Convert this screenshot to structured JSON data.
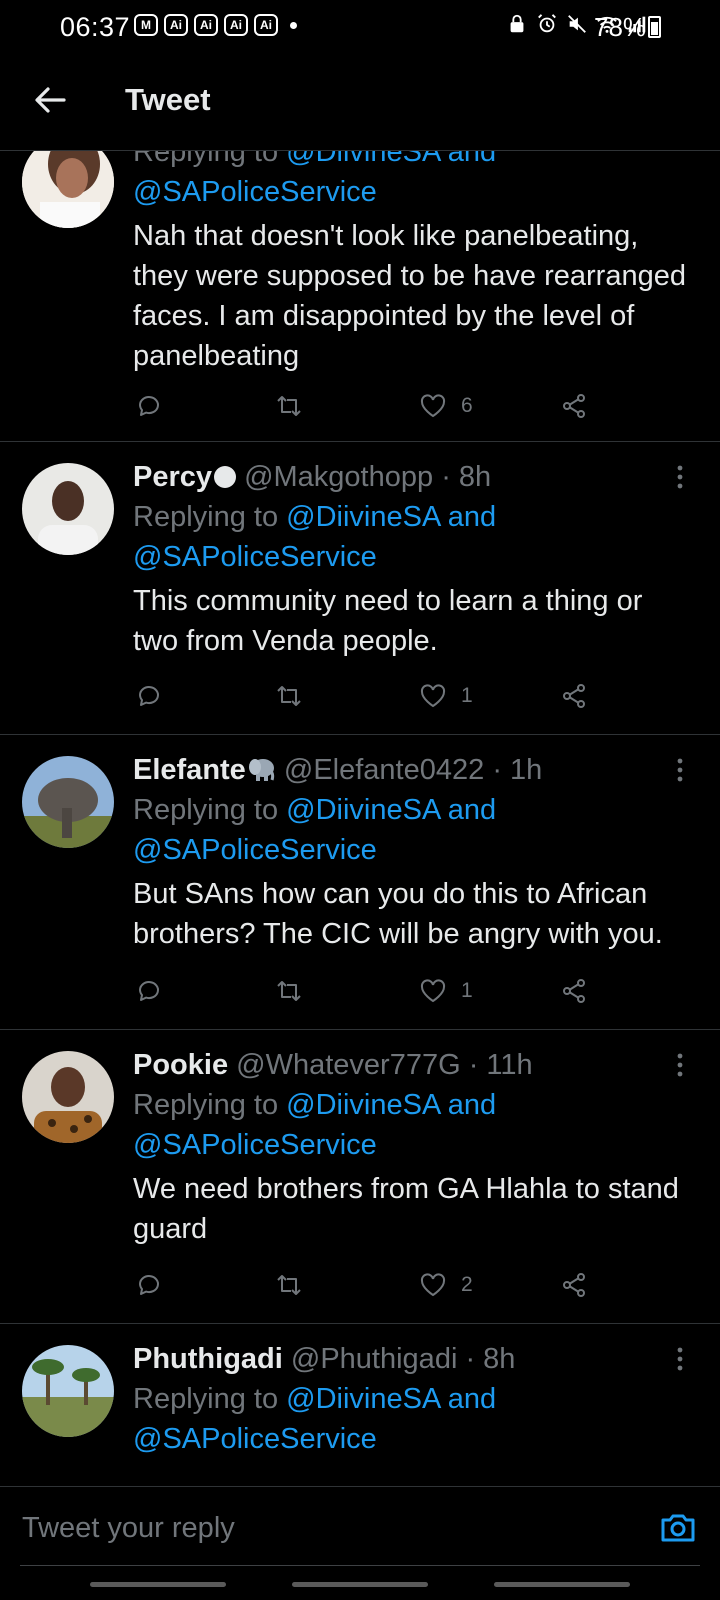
{
  "status_bar": {
    "time": "06:37",
    "notification_icons": [
      "M",
      "Ai",
      "Ai",
      "Ai",
      "Ai"
    ],
    "battery": "78%"
  },
  "header": {
    "title": "Tweet"
  },
  "tweets": [
    {
      "name": "",
      "handle": "",
      "reply_prefix": "Replying to",
      "reply_to_1": "@DiivineSA and",
      "reply_to_2": "@SAPoliceService",
      "text": "Nah that doesn't look like panelbeating, they were supposed to be have rearranged faces. I am disappointed by the level of panelbeating",
      "likes": "6"
    },
    {
      "name": "Percy",
      "handle": "@Makgothopp · 8h",
      "reply_prefix": "Replying to",
      "reply_to_1": "@DiivineSA and",
      "reply_to_2": "@SAPoliceService",
      "text": "This community need to learn a thing or two from Venda people.",
      "likes": "1"
    },
    {
      "name": "Elefante",
      "handle": "@Elefante0422 · 1h",
      "reply_prefix": "Replying to",
      "reply_to_1": "@DiivineSA and",
      "reply_to_2": "@SAPoliceService",
      "text": "But SAns how can you do this to  African brothers? The CIC will be angry with you.",
      "likes": "1"
    },
    {
      "name": "Pookie",
      "handle": "@Whatever777G · 11h",
      "reply_prefix": "Replying to",
      "reply_to_1": "@DiivineSA and",
      "reply_to_2": "@SAPoliceService",
      "text": "We need brothers from GA Hlahla to stand guard",
      "likes": "2"
    },
    {
      "name": "Phuthigadi",
      "handle": "@Phuthigadi · 8h",
      "reply_prefix": "Replying to",
      "reply_to_1": "@DiivineSA and",
      "reply_to_2": "@SAPoliceService"
    }
  ],
  "reply_bar": {
    "placeholder": "Tweet your reply"
  },
  "colors": {
    "background": "#000000",
    "link": "#1d9bf0",
    "muted": "#71767b",
    "divider": "#2f3336"
  }
}
